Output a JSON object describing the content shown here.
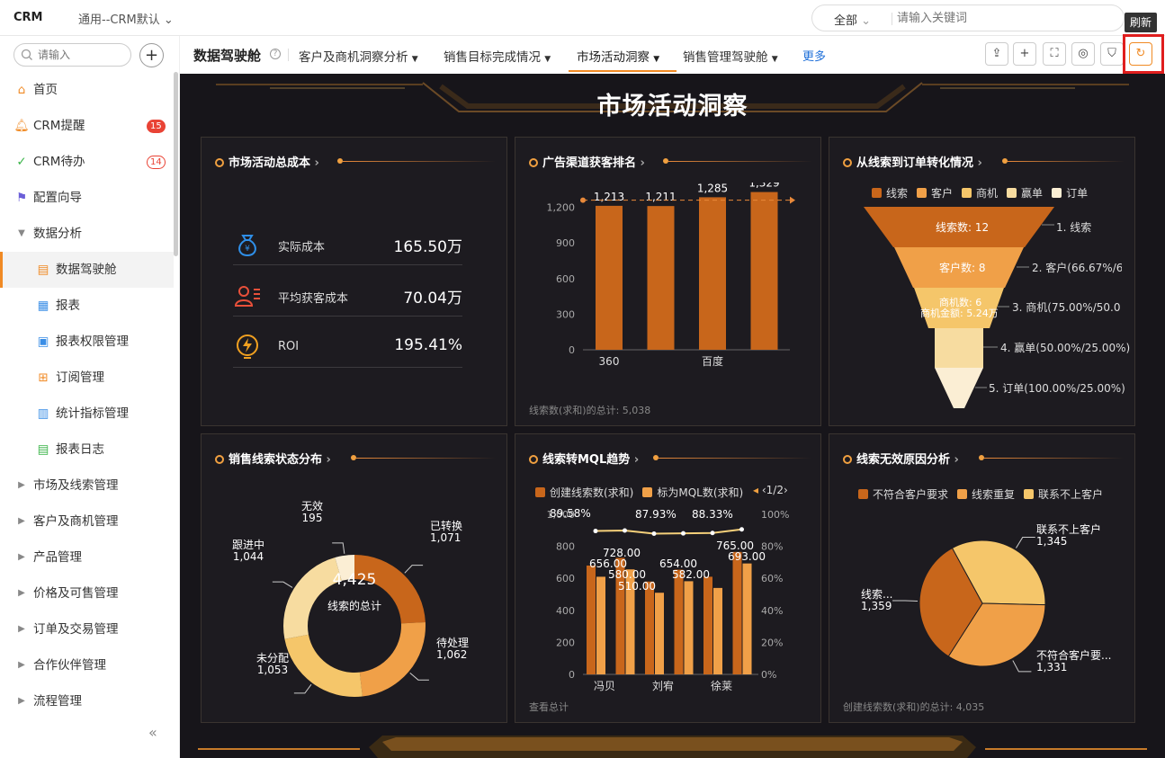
{
  "topbar": {
    "logo": "CRM",
    "workspace": "通用--CRM默认",
    "search_scope": "全部",
    "search_placeholder": "请输入关键词",
    "tooltip": "刷新"
  },
  "sidebar": {
    "search_placeholder": "请输入",
    "items": [
      {
        "label": "首页",
        "icon": "home-icon"
      },
      {
        "label": "CRM提醒",
        "icon": "bell-icon",
        "badge": "15"
      },
      {
        "label": "CRM待办",
        "icon": "check-circle-icon",
        "badge": "14"
      },
      {
        "label": "配置向导",
        "icon": "flag-icon"
      },
      {
        "label": "数据分析",
        "icon": "caret-down-icon"
      },
      {
        "label": "数据驾驶舱",
        "icon": "dashboard-icon"
      },
      {
        "label": "报表",
        "icon": "report-icon"
      },
      {
        "label": "报表权限管理",
        "icon": "report-permission-icon"
      },
      {
        "label": "订阅管理",
        "icon": "subscribe-icon"
      },
      {
        "label": "统计指标管理",
        "icon": "metrics-icon"
      },
      {
        "label": "报表日志",
        "icon": "log-icon"
      },
      {
        "label": "市场及线索管理",
        "icon": "caret-right-icon"
      },
      {
        "label": "客户及商机管理",
        "icon": "caret-right-icon"
      },
      {
        "label": "产品管理",
        "icon": "caret-right-icon"
      },
      {
        "label": "价格及可售管理",
        "icon": "caret-right-icon"
      },
      {
        "label": "订单及交易管理",
        "icon": "caret-right-icon"
      },
      {
        "label": "合作伙伴管理",
        "icon": "caret-right-icon"
      },
      {
        "label": "流程管理",
        "icon": "caret-right-icon"
      }
    ]
  },
  "tabs": {
    "title": "数据驾驶舱",
    "items": [
      "客户及商机洞察分析",
      "销售目标完成情况",
      "市场活动洞察",
      "销售管理驾驶舱"
    ],
    "more": "更多"
  },
  "dashboard": {
    "title": "市场活动洞察",
    "cost": {
      "title": "市场活动总成本",
      "rows": [
        {
          "label": "实际成本",
          "value": "165.50万"
        },
        {
          "label": "平均获客成本",
          "value": "70.04万"
        },
        {
          "label": "ROI",
          "value": "195.41%"
        }
      ]
    },
    "channel": {
      "title": "广告渠道获客排名",
      "footer": "线索数(求和)的总计: 5,038"
    },
    "funnel": {
      "title": "从线索到订单转化情况",
      "legend": [
        "线索",
        "客户",
        "商机",
        "赢单",
        "订单"
      ],
      "inner": [
        "线索数: 12",
        "客户数: 8",
        "商机数: 6",
        "商机金额: 5.24万"
      ],
      "right": [
        "1. 线索",
        "2. 客户(66.67%/66",
        "3. 商机(75.00%/50.00",
        "4. 赢单(50.00%/25.00%)",
        "5. 订单(100.00%/25.00%)"
      ]
    },
    "donut": {
      "title": "销售线索状态分布",
      "center_value": "4,425",
      "center_label": "线索的总计",
      "labels": [
        {
          "name": "已转换",
          "value": "1,071"
        },
        {
          "name": "待处理",
          "value": "1,062"
        },
        {
          "name": "未分配",
          "value": "1,053"
        },
        {
          "name": "跟进中",
          "value": "1,044"
        },
        {
          "name": "无效",
          "value": "195"
        }
      ]
    },
    "mql": {
      "title": "线索转MQL趋势",
      "legend": [
        "创建线索数(求和)",
        "标为MQL数(求和)"
      ],
      "pager": "1/2",
      "footer": "查看总计"
    },
    "invalid": {
      "title": "线索无效原因分析",
      "legend": [
        "不符合客户要求",
        "线索重复",
        "联系不上客户"
      ],
      "footer": "创建线索数(求和)的总计: 4,035",
      "labels": [
        {
          "name": "联系不上客户",
          "value": "1,345"
        },
        {
          "name": "线索...",
          "value": "1,359"
        },
        {
          "name": "不符合客户要...",
          "value": "1,331"
        }
      ]
    }
  },
  "chart_data": [
    {
      "type": "bar",
      "title": "广告渠道获客排名",
      "categories": [
        "360",
        "",
        "百度",
        ""
      ],
      "values": [
        1213,
        1211,
        1285,
        1329
      ],
      "data_labels": [
        "1,213",
        "1,211",
        "1,285",
        "1,329"
      ],
      "yticks": [
        "0",
        "300",
        "600",
        "900",
        "1,200",
        "1,500"
      ],
      "ylim": [
        0,
        1500
      ],
      "average_line": 1260
    },
    {
      "type": "bar",
      "title": "从线索到订单转化情况",
      "categories": [
        "线索",
        "客户",
        "商机",
        "赢单",
        "订单"
      ],
      "values": [
        12,
        8,
        6,
        3,
        3
      ]
    },
    {
      "type": "pie",
      "title": "销售线索状态分布",
      "categories": [
        "已转换",
        "待处理",
        "未分配",
        "跟进中",
        "无效"
      ],
      "values": [
        1071,
        1062,
        1053,
        1044,
        195
      ],
      "colors": [
        "#c8661b",
        "#f0a048",
        "#f5c66a",
        "#f7dca0",
        "#fbeed4"
      ]
    },
    {
      "type": "bar",
      "title": "线索转MQL趋势",
      "categories": [
        "冯贝",
        "",
        "刘宥",
        "",
        "徐莱",
        ""
      ],
      "series": [
        {
          "name": "创建线索数(求和)",
          "values": [
            680,
            728,
            580,
            654,
            610,
            765
          ]
        },
        {
          "name": "标为MQL数(求和)",
          "values": [
            610,
            656,
            510,
            582,
            540,
            693
          ]
        }
      ],
      "bar_labels": [
        "728.00",
        "656.00",
        "580.00",
        "510.00",
        "654.00",
        "582.00",
        "765.00",
        "693.00"
      ],
      "line": {
        "values": [
          89.58,
          89.9,
          87.93,
          88.1,
          88.33,
          90.6
        ],
        "labels": [
          "89.58%",
          "87.93%",
          "88.33%"
        ]
      },
      "yticks": [
        "0",
        "200",
        "400",
        "600",
        "800",
        "1,000"
      ],
      "y2ticks": [
        "0%",
        "20%",
        "40%",
        "60%",
        "80%",
        "100%"
      ],
      "ylim": [
        0,
        1000
      ],
      "y2lim": [
        0,
        100
      ]
    },
    {
      "type": "pie",
      "title": "线索无效原因分析",
      "categories": [
        "联系不上客户",
        "线索...",
        "不符合客户要..."
      ],
      "values": [
        1345,
        1359,
        1331
      ],
      "colors": [
        "#f5c66a",
        "#f0a048",
        "#c8661b"
      ]
    }
  ]
}
